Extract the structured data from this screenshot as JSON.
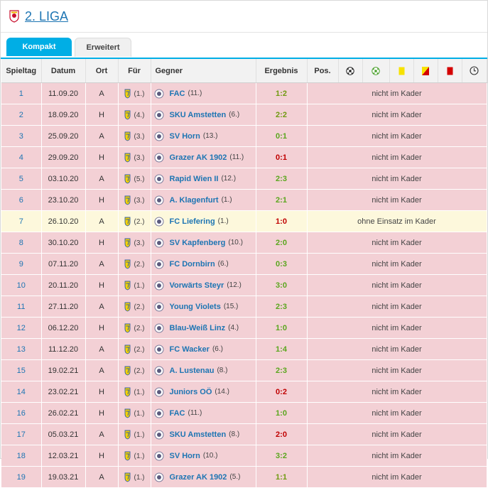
{
  "header": {
    "title": "2. LIGA"
  },
  "tabs": [
    {
      "label": "Kompakt",
      "active": true
    },
    {
      "label": "Erweitert",
      "active": false
    }
  ],
  "columns": {
    "spieltag": "Spieltag",
    "datum": "Datum",
    "ort": "Ort",
    "fuer": "Für",
    "gegner": "Gegner",
    "ergebnis": "Ergebnis",
    "pos": "Pos.",
    "icons": [
      "goal-icon",
      "assist-icon",
      "yellow-card-icon",
      "yellow-red-card-icon",
      "red-card-icon",
      "clock-icon"
    ]
  },
  "colors": {
    "accent": "#00aee5",
    "link": "#1d75b3",
    "row_bg": "#f3d0d5",
    "highlight_bg": "#fdf8dc",
    "win": "#5aa61e",
    "loss": "#c00000"
  },
  "rows": [
    {
      "spieltag": "1",
      "datum": "11.09.20",
      "ort": "A",
      "fuer_rank": "(1.)",
      "gegner": "FAC",
      "gegner_rank": "(11.)",
      "ergebnis": "1:2",
      "result": "draw",
      "status": "nicht im Kader",
      "icon": "fac-logo-icon"
    },
    {
      "spieltag": "2",
      "datum": "18.09.20",
      "ort": "H",
      "fuer_rank": "(4.)",
      "gegner": "SKU Amstetten",
      "gegner_rank": "(6.)",
      "ergebnis": "2:2",
      "result": "draw",
      "status": "nicht im Kader",
      "icon": "amstetten-logo-icon"
    },
    {
      "spieltag": "3",
      "datum": "25.09.20",
      "ort": "A",
      "fuer_rank": "(3.)",
      "gegner": "SV Horn",
      "gegner_rank": "(13.)",
      "ergebnis": "0:1",
      "result": "win",
      "status": "nicht im Kader",
      "icon": "horn-logo-icon"
    },
    {
      "spieltag": "4",
      "datum": "29.09.20",
      "ort": "H",
      "fuer_rank": "(3.)",
      "gegner": "Grazer AK 1902",
      "gegner_rank": "(11.)",
      "ergebnis": "0:1",
      "result": "loss",
      "status": "nicht im Kader",
      "icon": "gak-logo-icon"
    },
    {
      "spieltag": "5",
      "datum": "03.10.20",
      "ort": "A",
      "fuer_rank": "(5.)",
      "gegner": "Rapid Wien II",
      "gegner_rank": "(12.)",
      "ergebnis": "2:3",
      "result": "win",
      "status": "nicht im Kader",
      "icon": "rapid-logo-icon"
    },
    {
      "spieltag": "6",
      "datum": "23.10.20",
      "ort": "H",
      "fuer_rank": "(3.)",
      "gegner": "A. Klagenfurt",
      "gegner_rank": "(1.)",
      "ergebnis": "2:1",
      "result": "win",
      "status": "nicht im Kader",
      "icon": "klagenfurt-logo-icon"
    },
    {
      "spieltag": "7",
      "datum": "26.10.20",
      "ort": "A",
      "fuer_rank": "(2.)",
      "gegner": "FC Liefering",
      "gegner_rank": "(1.)",
      "ergebnis": "1:0",
      "result": "loss",
      "status": "ohne Einsatz im Kader",
      "icon": "liefering-logo-icon",
      "highlight": true
    },
    {
      "spieltag": "8",
      "datum": "30.10.20",
      "ort": "H",
      "fuer_rank": "(3.)",
      "gegner": "SV Kapfenberg",
      "gegner_rank": "(10.)",
      "ergebnis": "2:0",
      "result": "win",
      "status": "nicht im Kader",
      "icon": "kapfenberg-logo-icon"
    },
    {
      "spieltag": "9",
      "datum": "07.11.20",
      "ort": "A",
      "fuer_rank": "(2.)",
      "gegner": "FC Dornbirn",
      "gegner_rank": "(6.)",
      "ergebnis": "0:3",
      "result": "win",
      "status": "nicht im Kader",
      "icon": "dornbirn-logo-icon"
    },
    {
      "spieltag": "10",
      "datum": "20.11.20",
      "ort": "H",
      "fuer_rank": "(1.)",
      "gegner": "Vorwärts Steyr",
      "gegner_rank": "(12.)",
      "ergebnis": "3:0",
      "result": "win",
      "status": "nicht im Kader",
      "icon": "steyr-logo-icon"
    },
    {
      "spieltag": "11",
      "datum": "27.11.20",
      "ort": "A",
      "fuer_rank": "(2.)",
      "gegner": "Young Violets",
      "gegner_rank": "(15.)",
      "ergebnis": "2:3",
      "result": "win",
      "status": "nicht im Kader",
      "icon": "violets-logo-icon"
    },
    {
      "spieltag": "12",
      "datum": "06.12.20",
      "ort": "H",
      "fuer_rank": "(2.)",
      "gegner": "Blau-Weiß Linz",
      "gegner_rank": "(4.)",
      "ergebnis": "1:0",
      "result": "win",
      "status": "nicht im Kader",
      "icon": "bwlinz-logo-icon"
    },
    {
      "spieltag": "13",
      "datum": "11.12.20",
      "ort": "A",
      "fuer_rank": "(2.)",
      "gegner": "FC Wacker",
      "gegner_rank": "(6.)",
      "ergebnis": "1:4",
      "result": "win",
      "status": "nicht im Kader",
      "icon": "wacker-logo-icon"
    },
    {
      "spieltag": "15",
      "datum": "19.02.21",
      "ort": "A",
      "fuer_rank": "(2.)",
      "gegner": "A. Lustenau",
      "gegner_rank": "(8.)",
      "ergebnis": "2:3",
      "result": "win",
      "status": "nicht im Kader",
      "icon": "lustenau-logo-icon"
    },
    {
      "spieltag": "14",
      "datum": "23.02.21",
      "ort": "H",
      "fuer_rank": "(1.)",
      "gegner": "Juniors OÖ",
      "gegner_rank": "(14.)",
      "ergebnis": "0:2",
      "result": "loss",
      "status": "nicht im Kader",
      "icon": "juniors-logo-icon"
    },
    {
      "spieltag": "16",
      "datum": "26.02.21",
      "ort": "H",
      "fuer_rank": "(1.)",
      "gegner": "FAC",
      "gegner_rank": "(11.)",
      "ergebnis": "1:0",
      "result": "win",
      "status": "nicht im Kader",
      "icon": "fac-logo-icon"
    },
    {
      "spieltag": "17",
      "datum": "05.03.21",
      "ort": "A",
      "fuer_rank": "(1.)",
      "gegner": "SKU Amstetten",
      "gegner_rank": "(8.)",
      "ergebnis": "2:0",
      "result": "loss",
      "status": "nicht im Kader",
      "icon": "amstetten-logo-icon"
    },
    {
      "spieltag": "18",
      "datum": "12.03.21",
      "ort": "H",
      "fuer_rank": "(1.)",
      "gegner": "SV Horn",
      "gegner_rank": "(10.)",
      "ergebnis": "3:2",
      "result": "win",
      "status": "nicht im Kader",
      "icon": "horn-logo-icon"
    },
    {
      "spieltag": "19",
      "datum": "19.03.21",
      "ort": "A",
      "fuer_rank": "(1.)",
      "gegner": "Grazer AK 1902",
      "gegner_rank": "(5.)",
      "ergebnis": "1:1",
      "result": "draw",
      "status": "nicht im Kader",
      "icon": "gak-logo-icon"
    }
  ]
}
